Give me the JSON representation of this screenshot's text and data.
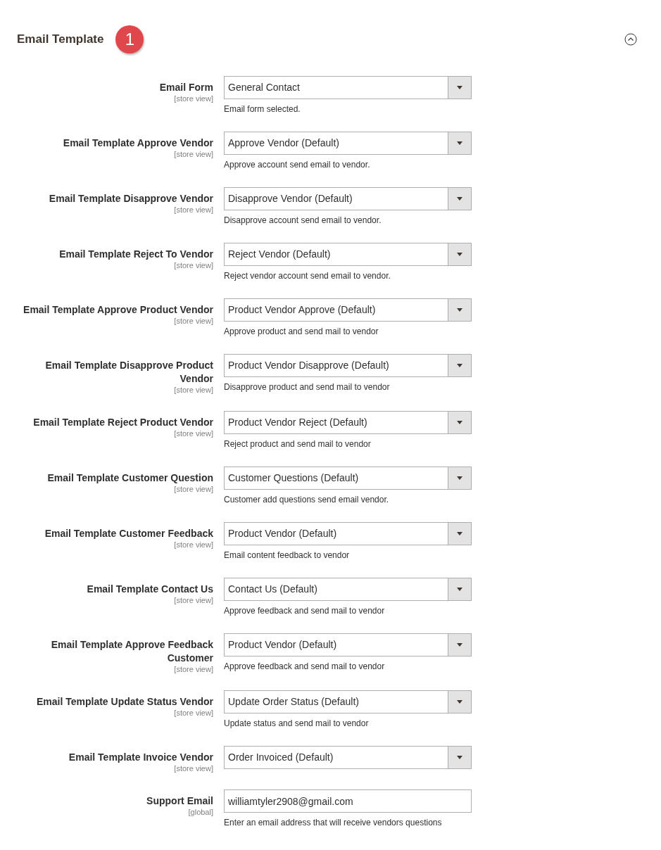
{
  "section": {
    "title": "Email Template",
    "badge": "1",
    "expanded": true
  },
  "fields": [
    {
      "kind": "select",
      "label": "Email Form",
      "scope": "[store view]",
      "value": "General Contact",
      "note": "Email form selected."
    },
    {
      "kind": "select",
      "label": "Email Template Approve Vendor",
      "scope": "[store view]",
      "value": "Approve Vendor (Default)",
      "note": "Approve account send email to vendor."
    },
    {
      "kind": "select",
      "label": "Email Template Disapprove Vendor",
      "scope": "[store view]",
      "value": "Disapprove Vendor (Default)",
      "note": "Disapprove account send email to vendor."
    },
    {
      "kind": "select",
      "label": "Email Template Reject To Vendor",
      "scope": "[store view]",
      "value": "Reject Vendor (Default)",
      "note": "Reject vendor account send email to vendor."
    },
    {
      "kind": "select",
      "label": "Email Template Approve Product Vendor",
      "scope": "[store view]",
      "value": "Product Vendor Approve (Default)",
      "note": "Approve product and send mail to vendor"
    },
    {
      "kind": "select",
      "label": "Email Template Disapprove Product Vendor",
      "scope": "[store view]",
      "value": "Product Vendor Disapprove (Default)",
      "note": "Disapprove product and send mail to vendor"
    },
    {
      "kind": "select",
      "label": "Email Template Reject Product Vendor",
      "scope": "[store view]",
      "value": "Product Vendor Reject (Default)",
      "note": "Reject product and send mail to vendor"
    },
    {
      "kind": "select",
      "label": "Email Template Customer Question",
      "scope": "[store view]",
      "value": "Customer Questions (Default)",
      "note": "Customer add questions send email vendor."
    },
    {
      "kind": "select",
      "label": "Email Template Customer Feedback",
      "scope": "[store view]",
      "value": "Product Vendor (Default)",
      "note": "Email content feedback to vendor"
    },
    {
      "kind": "select",
      "label": "Email Template Contact Us",
      "scope": "[store view]",
      "value": "Contact Us (Default)",
      "note": "Approve feedback and send mail to vendor"
    },
    {
      "kind": "select",
      "label": "Email Template Approve Feedback Customer",
      "scope": "[store view]",
      "value": "Product Vendor (Default)",
      "note": "Approve feedback and send mail to vendor"
    },
    {
      "kind": "select",
      "label": "Email Template Update Status Vendor",
      "scope": "[store view]",
      "value": "Update Order Status (Default)",
      "note": "Update status and send mail to vendor"
    },
    {
      "kind": "select",
      "label": "Email Template Invoice Vendor",
      "scope": "[store view]",
      "value": "Order Invoiced (Default)"
    },
    {
      "kind": "text",
      "label": "Support Email",
      "scope": "[global]",
      "value": "williamtyler2908@gmail.com",
      "note": "Enter an email address that will receive vendors questions"
    }
  ]
}
